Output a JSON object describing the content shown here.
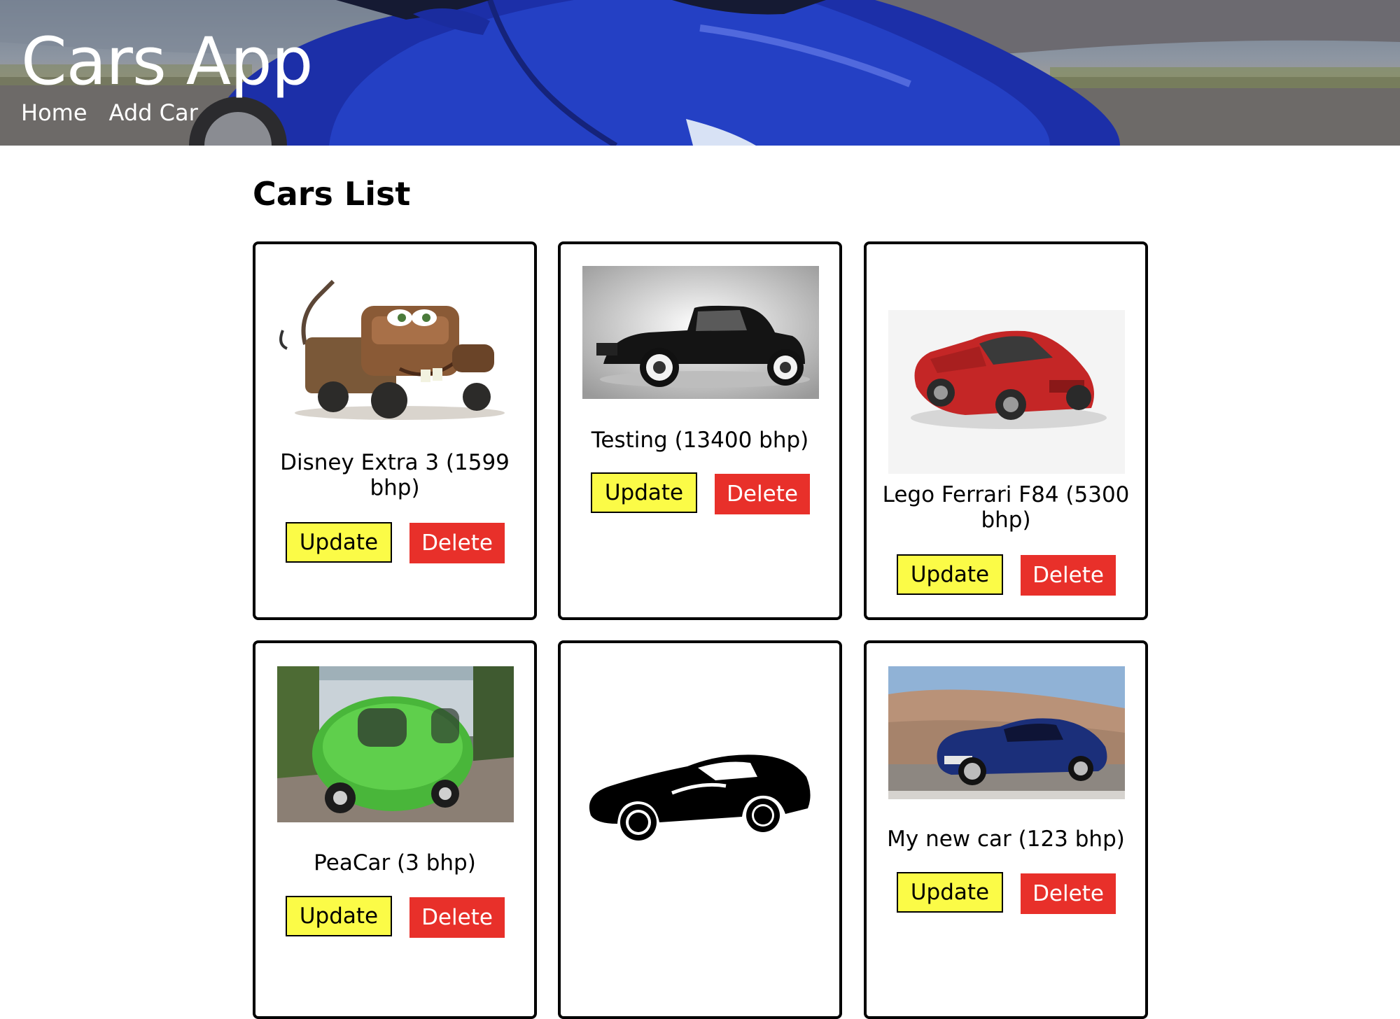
{
  "header": {
    "brand": "Cars App",
    "nav": [
      {
        "label": "Home"
      },
      {
        "label": "Add Car"
      }
    ]
  },
  "main": {
    "title": "Cars List",
    "cars": [
      {
        "label": "Disney Extra 3 (1599 bhp)",
        "image": "tow-truck-cartoon-photo"
      },
      {
        "label": "Testing (13400 bhp)",
        "image": "vintage-black-coupe-photo"
      },
      {
        "label": "Lego Ferrari F84 (5300 bhp)",
        "image": "red-lego-sports-car-photo"
      },
      {
        "label": "PeaCar (3 bhp)",
        "image": "green-pod-car-photo"
      },
      {
        "label": "",
        "image": "car-silhouette"
      },
      {
        "label": "My new car (123 bhp)",
        "image": "blue-supercar-photo"
      }
    ],
    "update_label": "Update",
    "delete_label": "Delete"
  },
  "colors": {
    "update_button": "#fbfb47",
    "delete_button": "#e8302a",
    "card_border": "#000000"
  }
}
